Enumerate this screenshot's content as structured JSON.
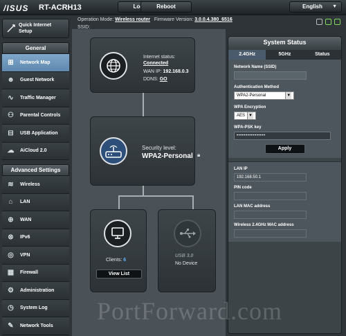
{
  "brand": {
    "logo": "/ISUS",
    "model": "RT-ACRH13"
  },
  "topbar": {
    "logout_label": "Logout",
    "reboot_label": "Reboot",
    "language": "English"
  },
  "info": {
    "op_mode_label": "Operation Mode:",
    "op_mode_value": "Wireless router",
    "fw_label": "Firmware Version:",
    "fw_value": "3.0.0.4.380_6516",
    "ssid_label": "SSID:"
  },
  "sidebar": {
    "quick_setup": "Quick Internet Setup",
    "general_title": "General",
    "general_items": [
      {
        "label": "Network Map",
        "icon": "network-map-icon",
        "active": true
      },
      {
        "label": "Guest Network",
        "icon": "guest-network-icon"
      },
      {
        "label": "Traffic Manager",
        "icon": "traffic-manager-icon"
      },
      {
        "label": "Parental Controls",
        "icon": "parental-controls-icon"
      },
      {
        "label": "USB Application",
        "icon": "usb-application-icon"
      },
      {
        "label": "AiCloud 2.0",
        "icon": "aicloud-icon"
      }
    ],
    "advanced_title": "Advanced Settings",
    "advanced_items": [
      {
        "label": "Wireless",
        "icon": "wireless-icon"
      },
      {
        "label": "LAN",
        "icon": "lan-icon"
      },
      {
        "label": "WAN",
        "icon": "wan-icon"
      },
      {
        "label": "IPv6",
        "icon": "ipv6-icon"
      },
      {
        "label": "VPN",
        "icon": "vpn-icon"
      },
      {
        "label": "Firewall",
        "icon": "firewall-icon"
      },
      {
        "label": "Administration",
        "icon": "administration-icon"
      },
      {
        "label": "System Log",
        "icon": "system-log-icon"
      },
      {
        "label": "Network Tools",
        "icon": "network-tools-icon"
      }
    ]
  },
  "map": {
    "internet_status_label": "Internet status:",
    "internet_status_value": "Connected",
    "wan_ip_label": "WAN IP:",
    "wan_ip_value": "192.168.0.3",
    "ddns_label": "DDNS:",
    "ddns_value": "GO",
    "security_label": "Security level:",
    "security_value": "WPA2-Personal",
    "clients_label": "Clients:",
    "clients_count": "6",
    "view_list_label": "View List",
    "usb_label": "USB 3.0",
    "usb_status": "No Device"
  },
  "system_status": {
    "title": "System Status",
    "tabs": [
      "2.4GHz",
      "5GHz",
      "Status"
    ],
    "network_name_label": "Network Name (SSID)",
    "auth_method_label": "Authentication Method",
    "auth_method_value": "WPA2-Personal",
    "wpa_encryption_label": "WPA Encryption",
    "wpa_encryption_value": "AES",
    "psk_label": "WPA-PSK key",
    "psk_value": "••••••••••••••••",
    "apply_label": "Apply",
    "lan_ip_label": "LAN IP",
    "lan_ip_value": "192.168.50.1",
    "pin_code_label": "PIN code",
    "lan_mac_label": "LAN MAC address",
    "wireless_mac_label": "Wireless 2.4GHz MAC address"
  },
  "watermark": "PortForward.com"
}
